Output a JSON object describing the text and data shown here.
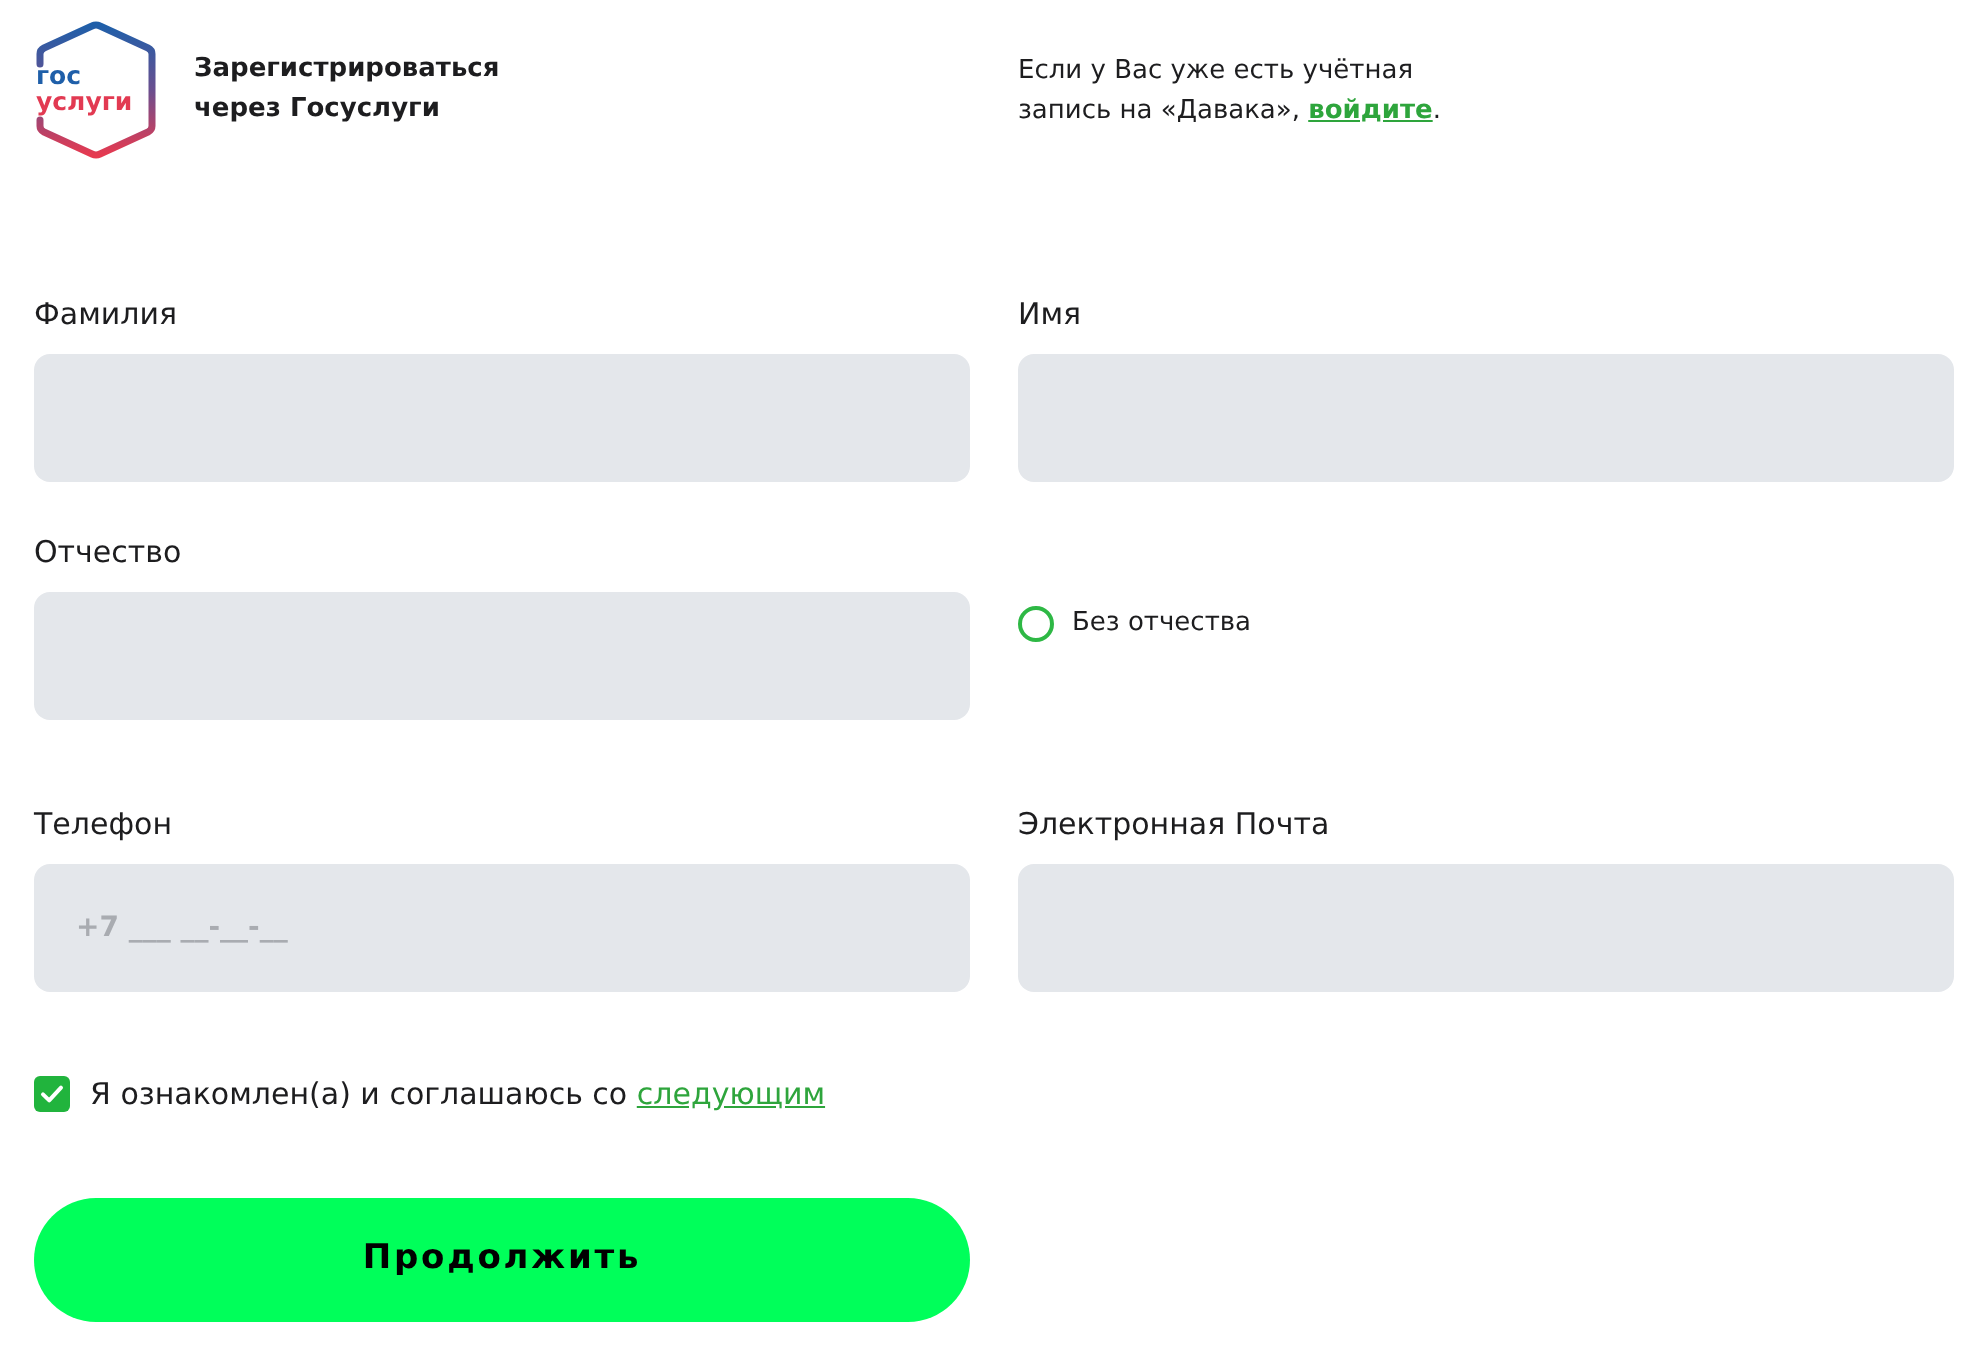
{
  "gosuslugi": {
    "logo_lines": [
      "гос",
      "услуги"
    ],
    "label_lines": [
      "Зарегистрироваться",
      "через Госуслуги"
    ]
  },
  "login_prompt": {
    "lines": [
      "Если у Вас уже есть учётная",
      "запись на «Давака», "
    ],
    "link": "войдите",
    "tail": "."
  },
  "fields": [
    {
      "kind": "input",
      "label": "Фамилия"
    },
    {
      "kind": "input",
      "label": "Имя"
    },
    {
      "kind": "input",
      "label": "Отчество"
    },
    {
      "kind": "radio",
      "label": "Без отчества",
      "checked": false
    },
    {
      "kind": "input",
      "label": "Телефон",
      "placeholder": "+7 ___ __-__-__"
    },
    {
      "kind": "input",
      "label": "Электронная Почта"
    }
  ],
  "consent": {
    "text": "Я ознакомлен(а) и соглашаюсь со ",
    "link": "следующим",
    "checked": true
  },
  "submit_button": "Продолжить"
}
